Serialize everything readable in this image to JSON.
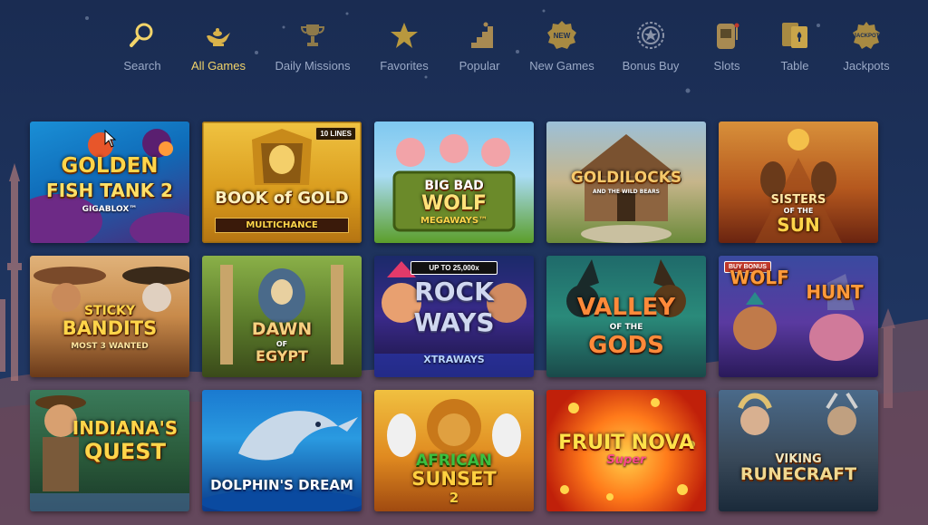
{
  "nav": {
    "items": [
      {
        "label": "Search",
        "icon": "search-icon",
        "active": false
      },
      {
        "label": "All Games",
        "icon": "genie-lamp-icon",
        "active": true
      },
      {
        "label": "Daily Missions",
        "icon": "trophy-icon",
        "active": false
      },
      {
        "label": "Favorites",
        "icon": "star-icon",
        "active": false
      },
      {
        "label": "Popular",
        "icon": "popular-stairs-icon",
        "active": false
      },
      {
        "label": "New Games",
        "icon": "new-badge-icon",
        "active": false
      },
      {
        "label": "Bonus Buy",
        "icon": "bonus-buy-icon",
        "active": false
      },
      {
        "label": "Slots",
        "icon": "slot-machine-icon",
        "active": false
      },
      {
        "label": "Table",
        "icon": "cards-icon",
        "active": false
      },
      {
        "label": "Jackpots",
        "icon": "jackpot-icon",
        "active": false
      }
    ],
    "new_badge_text": "NEW",
    "jackpot_badge_text": "JACKPOT"
  },
  "colors": {
    "background": "#1c2f55",
    "active_label": "#f2d46a",
    "inactive_label": "#9aa9c6",
    "icon_gold": "#d9b24a"
  },
  "games": [
    {
      "title": "GOLDEN",
      "title2": "FISH TANK 2",
      "sub": "GIGABLOX™"
    },
    {
      "title": "BOOK of GOLD",
      "sub": "MULTICHANCE",
      "badge": "10 LINES"
    },
    {
      "title": "BIG BAD",
      "title2": "WOLF",
      "sub": "MEGAWAYS™"
    },
    {
      "title": "GOLDILOCKS",
      "sub": "AND THE WILD BEARS"
    },
    {
      "title": "SISTERS",
      "title2": "SUN",
      "sub": "OF THE"
    },
    {
      "title": "STICKY",
      "title2": "BANDITS",
      "sub": "MOST 3 WANTED"
    },
    {
      "title": "DAWN",
      "title2": "EGYPT",
      "sub": "OF"
    },
    {
      "title": "ROCK",
      "title2": "WAYS",
      "sub": "XTRAWAYS",
      "badge": "UP TO 25,000x"
    },
    {
      "title": "VALLEY",
      "title2": "GODS",
      "sub": "OF THE"
    },
    {
      "title": "WOLF",
      "title2": "HUNT",
      "badge": "BUY BONUS"
    },
    {
      "title": "INDIANA'S",
      "title2": "QUEST"
    },
    {
      "title": "DOLPHIN'S DREAM"
    },
    {
      "title": "AFRICAN",
      "title2": "SUNSET",
      "sub": "2"
    },
    {
      "title": "FRUIT NOVA",
      "sub": "Super"
    },
    {
      "title": "VIKING",
      "title2": "RUNECRAFT"
    }
  ]
}
